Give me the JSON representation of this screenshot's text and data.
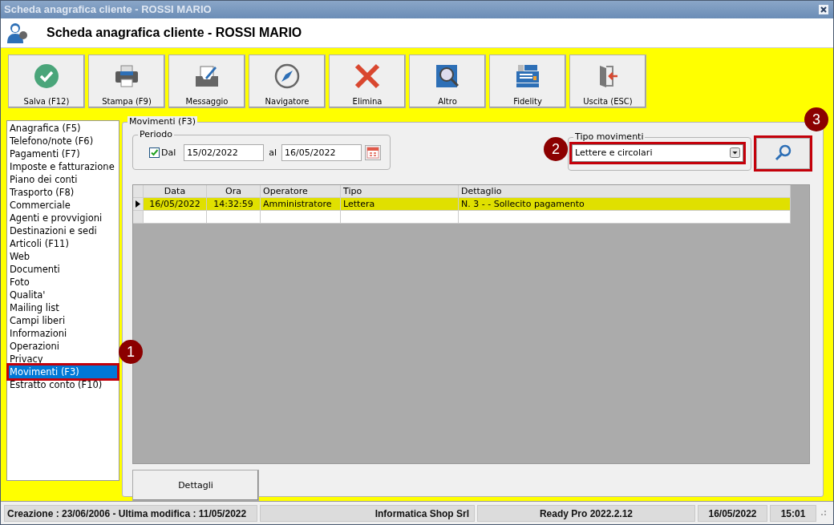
{
  "window": {
    "title": "Scheda anagrafica cliente - ROSSI MARIO"
  },
  "header": {
    "title": "Scheda anagrafica cliente - ROSSI MARIO"
  },
  "toolbar": [
    {
      "label": "Salva (F12)",
      "kind": "save"
    },
    {
      "label": "Stampa (F9)",
      "kind": "print"
    },
    {
      "label": "Messaggio",
      "kind": "message"
    },
    {
      "label": "Navigatore",
      "kind": "compass"
    },
    {
      "label": "Elimina",
      "kind": "delete"
    },
    {
      "label": "Altro",
      "kind": "other"
    },
    {
      "label": "Fidelity",
      "kind": "register"
    },
    {
      "label": "Uscita (ESC)",
      "kind": "exit"
    }
  ],
  "sidebar": {
    "items": [
      {
        "label": "Anagrafica (F5)",
        "selected": false,
        "highlighted": false
      },
      {
        "label": "Telefono/note (F6)",
        "selected": false,
        "highlighted": false
      },
      {
        "label": "Pagamenti (F7)",
        "selected": false,
        "highlighted": false
      },
      {
        "label": "Imposte e fatturazione",
        "selected": false,
        "highlighted": false
      },
      {
        "label": "Piano dei conti",
        "selected": false,
        "highlighted": false
      },
      {
        "label": "Trasporto (F8)",
        "selected": false,
        "highlighted": false
      },
      {
        "label": "Commerciale",
        "selected": false,
        "highlighted": false
      },
      {
        "label": "Agenti e provvigioni",
        "selected": false,
        "highlighted": false
      },
      {
        "label": "Destinazioni e sedi",
        "selected": false,
        "highlighted": false
      },
      {
        "label": "Articoli (F11)",
        "selected": false,
        "highlighted": false
      },
      {
        "label": "Web",
        "selected": false,
        "highlighted": false
      },
      {
        "label": "Documenti",
        "selected": false,
        "highlighted": false
      },
      {
        "label": "Foto",
        "selected": false,
        "highlighted": false
      },
      {
        "label": "Qualita'",
        "selected": false,
        "highlighted": false
      },
      {
        "label": "Mailing list",
        "selected": false,
        "highlighted": false
      },
      {
        "label": "Campi liberi",
        "selected": false,
        "highlighted": false
      },
      {
        "label": "Informazioni",
        "selected": false,
        "highlighted": false
      },
      {
        "label": "Operazioni",
        "selected": false,
        "highlighted": false
      },
      {
        "label": "Privacy",
        "selected": false,
        "highlighted": false
      },
      {
        "label": "Movimenti (F3)",
        "selected": true,
        "highlighted": true
      },
      {
        "label": "Estratto conto (F10)",
        "selected": false,
        "highlighted": false
      }
    ]
  },
  "panel": {
    "title": "Movimenti (F3)",
    "period": {
      "title": "Periodo",
      "from_checkbox": {
        "label": "Dal",
        "checked": true
      },
      "from": "15/02/2022",
      "to_label": "al",
      "to": "16/05/2022"
    },
    "type_filter": {
      "title": "Tipo movimenti",
      "value": "Lettere e circolari",
      "highlighted": true
    },
    "search_button": {
      "highlighted": true
    },
    "table": {
      "columns": [
        "Data",
        "Ora",
        "Operatore",
        "Tipo",
        "Dettaglio"
      ],
      "rows": [
        {
          "cells": [
            "16/05/2022",
            "14:32:59",
            "Amministratore",
            "Lettera",
            "N. 3 -  - Sollecito pagamento"
          ],
          "selected": true
        },
        {
          "cells": [],
          "selected": false
        }
      ]
    },
    "details_button": "Dettagli"
  },
  "annotations": [
    {
      "number": "1"
    },
    {
      "number": "2"
    },
    {
      "number": "3"
    }
  ],
  "status_bar": [
    "Creazione : 23/06/2006 - Ultima modifica : 11/05/2022",
    "Informatica Shop Srl",
    "Ready Pro 2022.2.12",
    "16/05/2022",
    "15:01"
  ]
}
